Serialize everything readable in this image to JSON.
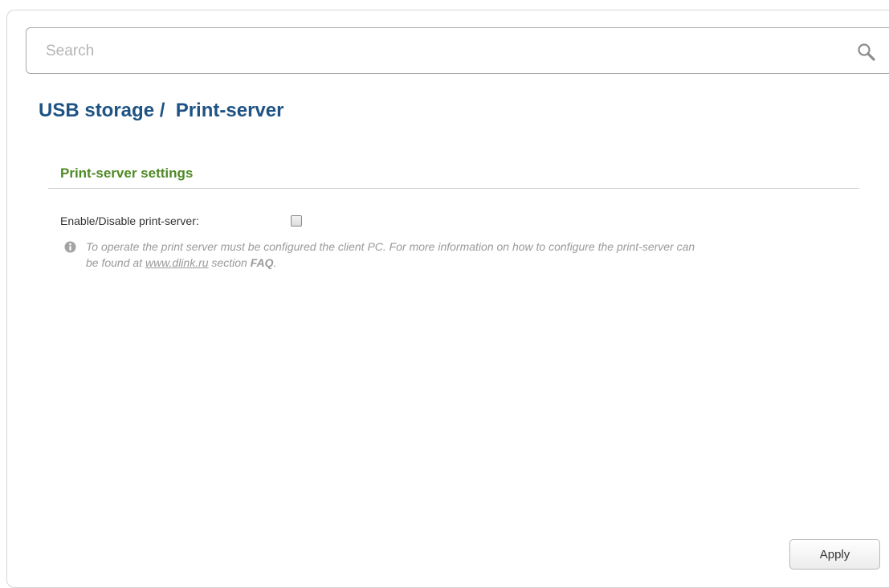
{
  "search": {
    "placeholder": "Search",
    "icon": "search-icon"
  },
  "page": {
    "title": "USB storage /  Print-server"
  },
  "section": {
    "title": "Print-server settings"
  },
  "form": {
    "enable_label": "Enable/Disable print-server:",
    "enable_checked": false
  },
  "info": {
    "icon": "info-icon",
    "text_part1": "To operate the print server must be configured the client PC. For more information on how to configure the print-server can be found at ",
    "link_text": "www.dlink.ru",
    "text_part2": " section ",
    "bold_text": "FAQ",
    "text_part3": "."
  },
  "actions": {
    "apply_label": "Apply"
  },
  "colors": {
    "title": "#1e5384",
    "section_title": "#4e8a24",
    "hint_text": "#9a9a9a"
  }
}
